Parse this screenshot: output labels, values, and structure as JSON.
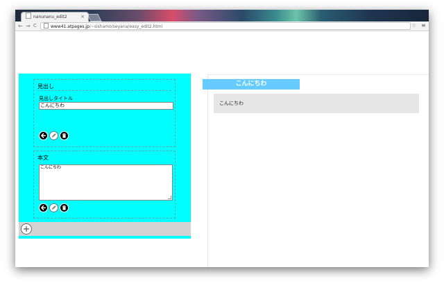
{
  "browser": {
    "tab_title": "nanunanu_edit2",
    "tab_close": "×",
    "back": "←",
    "forward": "→",
    "reload": "C",
    "url_host": "www41.atpages.jp",
    "url_path": "/~sishamo/seyana/easy_edit2.html",
    "star": "☆",
    "menu": "≡"
  },
  "editor": {
    "heading_block": {
      "title": "見出し",
      "field_label": "見出しタイトル",
      "field_value": "こんにちわ"
    },
    "body_block": {
      "title": "本文",
      "textarea_value": "こんにちわ"
    },
    "colors": {
      "editor_bg": "#00ffff",
      "add_bar_bg": "#d3d3d3"
    },
    "icons": [
      "arrow-left-icon",
      "pencil-icon",
      "trash-icon",
      "plus-icon"
    ]
  },
  "preview": {
    "heading": "こんにちわ",
    "body_text": "こんにちわ",
    "colors": {
      "heading_bg": "#66ccff",
      "body_bg": "#e6e6e6"
    }
  }
}
